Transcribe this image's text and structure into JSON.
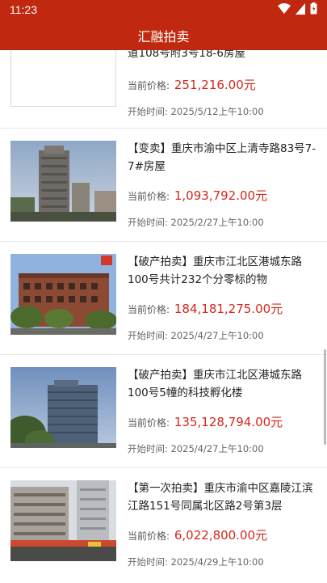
{
  "status_bar": {
    "time": "11:23"
  },
  "app_bar": {
    "title": "汇融拍卖"
  },
  "labels": {
    "price_label": "当前价格:",
    "start_label": "开始时间:"
  },
  "items": [
    {
      "title": "道108号附3号18-6房屋",
      "price": "251,216.00元",
      "start": "2025/5/12上午10:00",
      "image": "blank-placeholder"
    },
    {
      "title": "【变卖】重庆市渝中区上清寺路83号7-7#房屋",
      "price": "1,093,792.00元",
      "start": "2025/2/27上午10:00",
      "image": "high-rise-tower"
    },
    {
      "title": "【破产拍卖】重庆市江北区港城东路100号共计232个分零标的物",
      "price": "184,181,275.00元",
      "start": "2025/4/27上午10:00",
      "image": "brick-building"
    },
    {
      "title": "【破产拍卖】重庆市江北区港城东路100号5幢的科技孵化楼",
      "price": "135,128,794.00元",
      "start": "2025/4/27上午10:00",
      "image": "glass-tower"
    },
    {
      "title": "【第一次拍卖】重庆市渝中区嘉陵江滨江路151号同属北区路2号第3层",
      "price": "6,022,800.00元",
      "start": "2025/4/29上午10:00",
      "image": "street-buildings"
    }
  ]
}
